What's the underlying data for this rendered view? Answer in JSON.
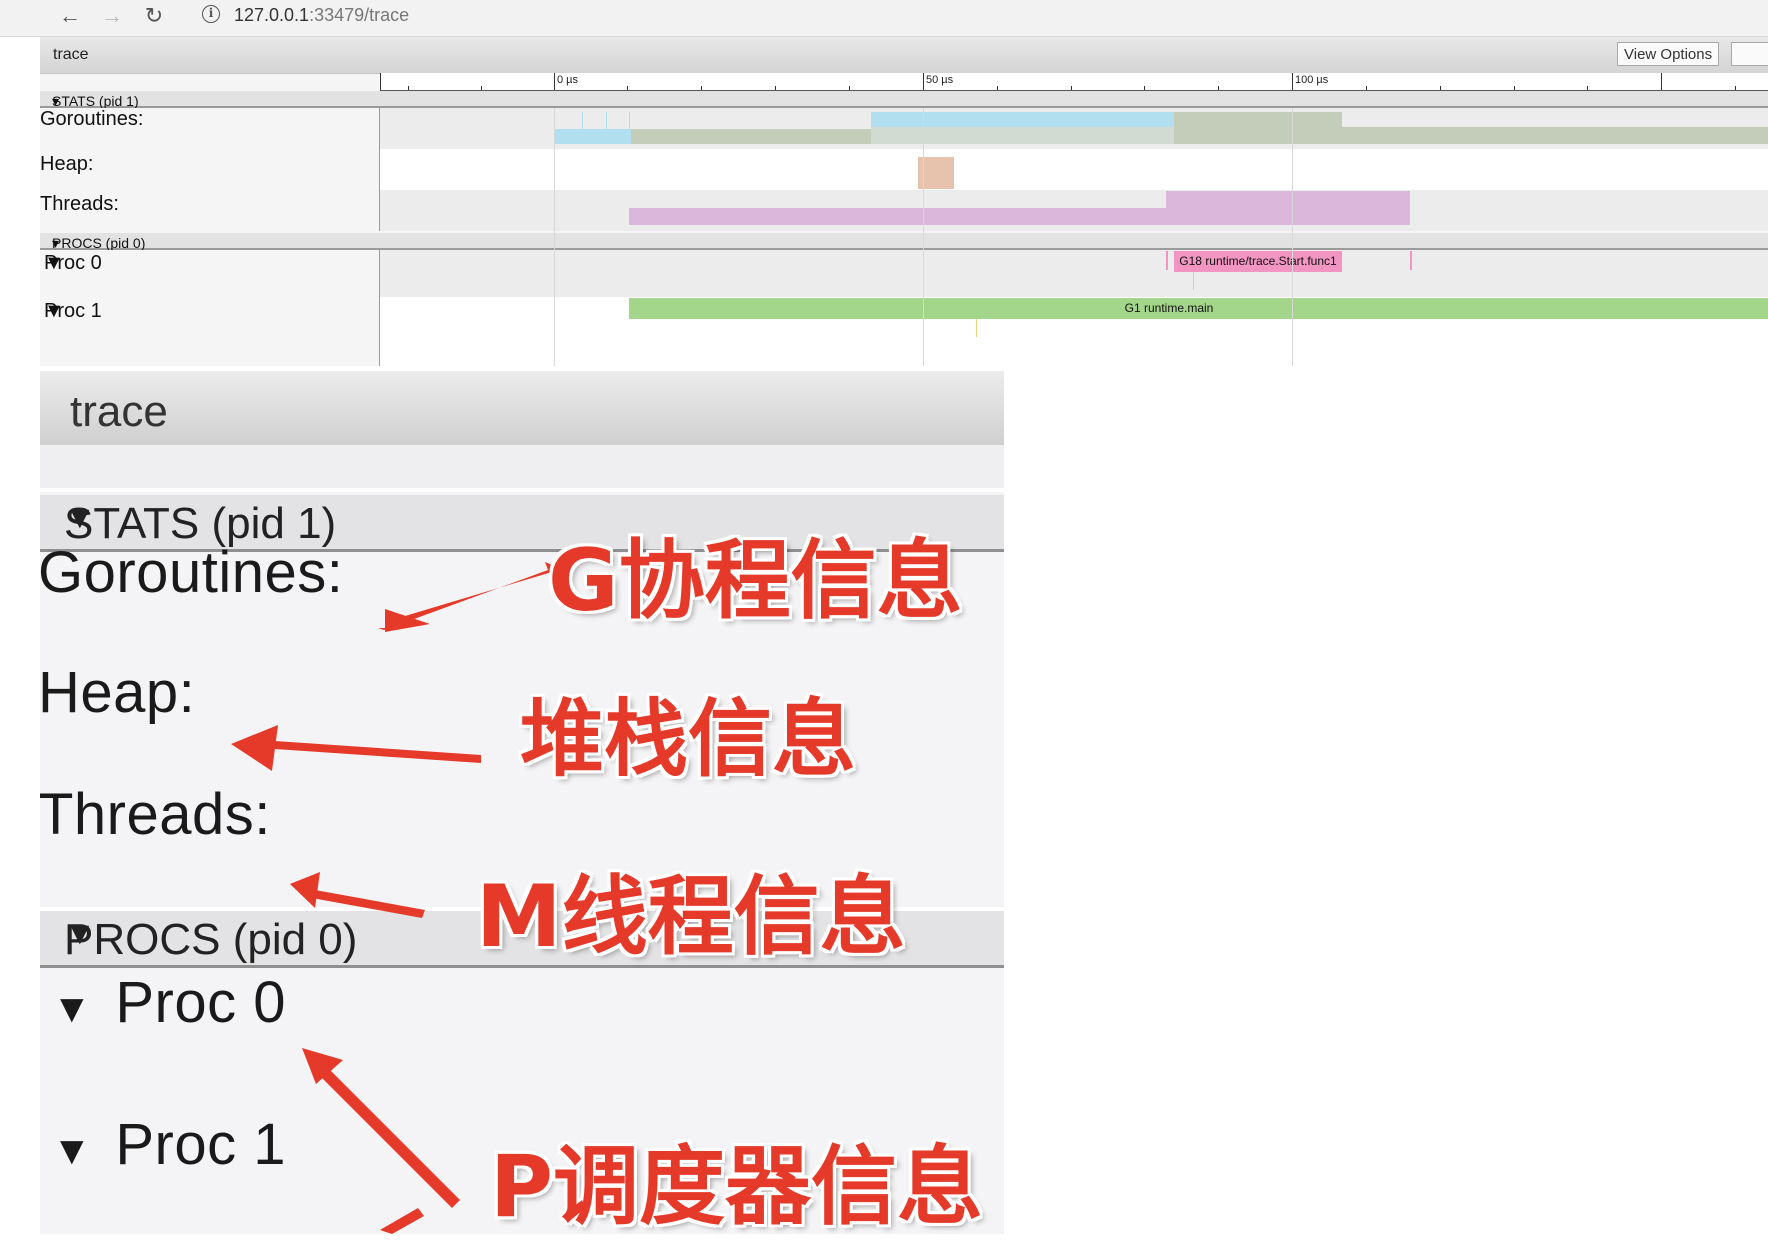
{
  "browser": {
    "url_host": "127.0.0.1",
    "url_rest": ":33479/trace"
  },
  "viewer": {
    "title": "trace",
    "view_options_label": "View Options",
    "ruler_labels": [
      "0 µs",
      "50 µs",
      "100 µs"
    ],
    "sections": {
      "stats": "STATS (pid 1)",
      "procs": "PROCS (pid 0)"
    },
    "rows": {
      "goroutines": "Goroutines:",
      "heap": "Heap:",
      "threads": "Threads:",
      "proc0": "Proc 0",
      "proc1": "Proc 1"
    },
    "slices": {
      "proc0": "G18 runtime/trace.Start.func1",
      "proc1": "G1 runtime.main"
    },
    "colors": {
      "goroutine_running": "#b1dff0",
      "goroutine_runnable": "#c4ccba",
      "heap": "#e7c2ad",
      "threads": "#dcb7dc",
      "proc0_slice": "#f295c2",
      "proc1_slice": "#a3d68a"
    }
  },
  "zoom": {
    "title": "trace",
    "sections": {
      "stats": "STATS (pid 1)",
      "procs": "PROCS (pid 0)"
    },
    "rows": {
      "goroutines": "Goroutines:",
      "heap": "Heap:",
      "threads": "Threads:",
      "proc0": "Proc 0",
      "proc1": "Proc 1"
    }
  },
  "annotations": {
    "goroutines": "G协程信息",
    "heap": "堆栈信息",
    "threads": "M线程信息",
    "procs": "P调度器信息",
    "color": "#e5392a"
  }
}
